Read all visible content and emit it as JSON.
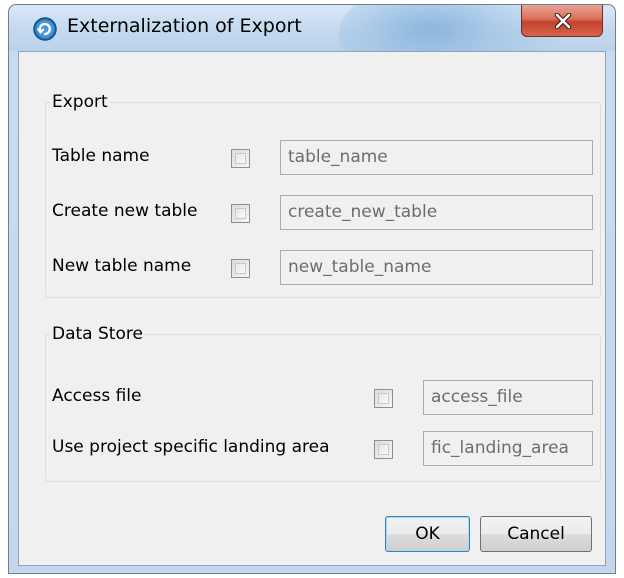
{
  "window": {
    "title": "Externalization of Export",
    "icons": {
      "app": "circular-arrow-icon",
      "close": "close-x-icon"
    }
  },
  "export_group": {
    "legend": "Export",
    "rows": [
      {
        "label": "Table name",
        "checked": false,
        "value": "table_name"
      },
      {
        "label": "Create new table",
        "checked": false,
        "value": "create_new_table"
      },
      {
        "label": "New table name",
        "checked": false,
        "value": "new_table_name"
      }
    ]
  },
  "datastore_group": {
    "legend": "Data Store",
    "rows": [
      {
        "label": "Access file",
        "checked": false,
        "value": "access_file"
      },
      {
        "label": "Use project specific landing area",
        "checked": false,
        "value": "fic_landing_area"
      }
    ]
  },
  "buttons": {
    "ok": "OK",
    "cancel": "Cancel"
  },
  "colors": {
    "title_bg": "#c4d9ee",
    "client_bg": "#f0f0f0",
    "close_red": "#c4412a",
    "default_button_border": "#3c7fb1"
  }
}
